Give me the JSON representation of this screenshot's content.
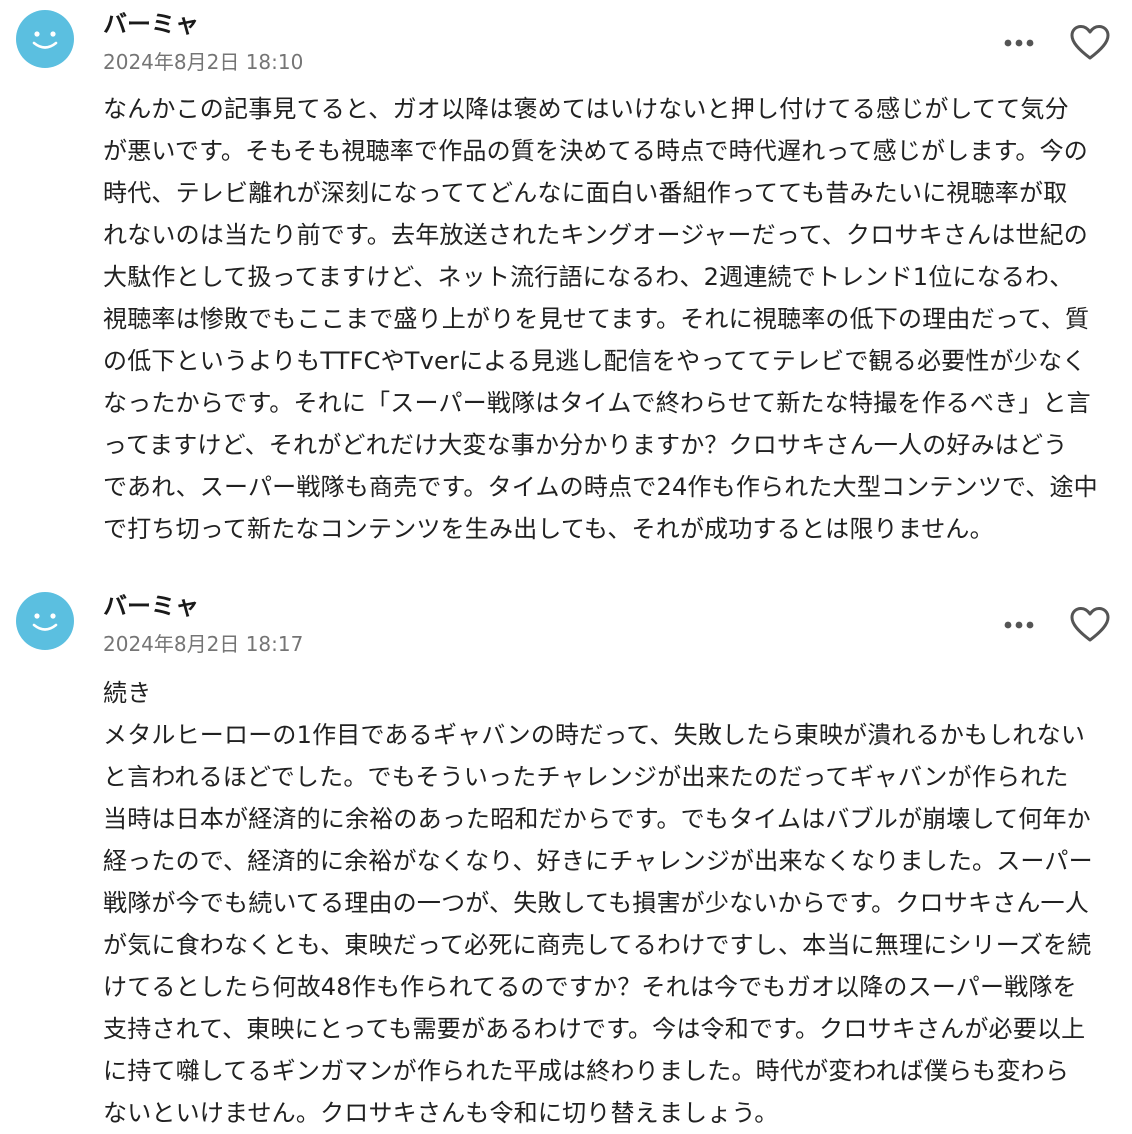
{
  "comments": [
    {
      "username": "バーミャ",
      "timestamp": "2024年8月2日 18:10",
      "avatar_icon": "smiley-face-avatar",
      "more_icon": "more-horizontal-icon",
      "like_icon": "heart-outline-icon",
      "lines": [
        "なんかこの記事見てると、ガオ以降は褒めてはいけないと押し付けてる感じがしてて気分",
        "が悪いです。そもそも視聴率で作品の質を決めてる時点で時代遅れって感じがします。今の",
        "時代、テレビ離れが深刻になっててどんなに面白い番組作ってても昔みたいに視聴率が取",
        "れないのは当たり前です。去年放送されたキングオージャーだって、クロサキさんは世紀の",
        "大駄作として扱ってますけど、ネット流行語になるわ、2週連続でトレンド1位になるわ、",
        "視聴率は惨敗でもここまで盛り上がりを見せてます。それに視聴率の低下の理由だって、質",
        "の低下というよりもTTFCやTverによる見逃し配信をやっててテレビで観る必要性が少なく",
        "なったからです。それに「スーパー戦隊はタイムで終わらせて新たな特撮を作るべき」と言",
        "ってますけど、それがどれだけ大変な事か分かりますか？クロサキさん一人の好みはどう",
        "であれ、スーパー戦隊も商売です。タイムの時点で24作も作られた大型コンテンツで、途中",
        "で打ち切って新たなコンテンツを生み出しても、それが成功するとは限りません。"
      ]
    },
    {
      "username": "バーミャ",
      "timestamp": "2024年8月2日 18:17",
      "avatar_icon": "smiley-face-avatar",
      "more_icon": "more-horizontal-icon",
      "like_icon": "heart-outline-icon",
      "lines": [
        "続き",
        "メタルヒーローの1作目であるギャバンの時だって、失敗したら東映が潰れるかもしれない",
        "と言われるほどでした。でもそういったチャレンジが出来たのだってギャバンが作られた",
        "当時は日本が経済的に余裕のあった昭和だからです。でもタイムはバブルが崩壊して何年か",
        "経ったので、経済的に余裕がなくなり、好きにチャレンジが出来なくなりました。スーパー",
        "戦隊が今でも続いてる理由の一つが、失敗しても損害が少ないからです。クロサキさん一人",
        "が気に食わなくとも、東映だって必死に商売してるわけですし、本当に無理にシリーズを続",
        "けてるとしたら何故48作も作られてるのですか？それは今でもガオ以降のスーパー戦隊を",
        "支持されて、東映にとっても需要があるわけです。今は令和です。クロサキさんが必要以上",
        "に持て囃してるギンガマンが作られた平成は終わりました。時代が変われば僕らも変わら",
        "ないといけません。クロサキさんも令和に切り替えましょう。"
      ]
    }
  ]
}
